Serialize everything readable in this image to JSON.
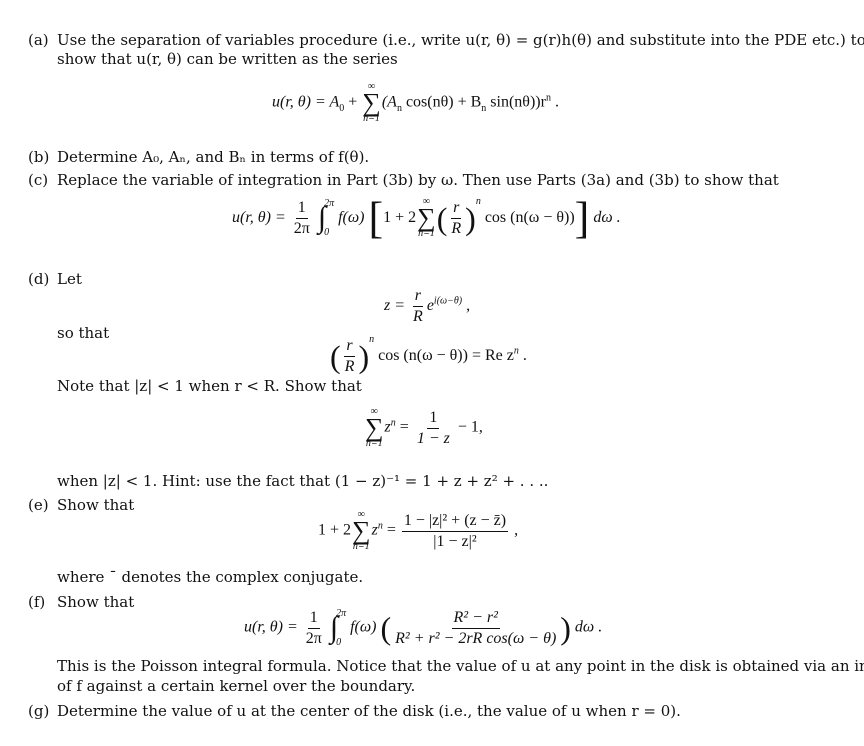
{
  "parts": {
    "a": {
      "label": "(a)",
      "line1": "Use the separation of variables procedure (i.e., write u(r, θ) = g(r)h(θ) and substitute into the PDE etc.)  to",
      "line2": "show that u(r, θ) can be written as the series",
      "equation": {
        "lhs": "u(r, θ) = A",
        "lhs_sub": "0",
        "plus": " + ",
        "sum_top": "∞",
        "sum_bottom": "n=1",
        "body": "(A",
        "body_sub": "n",
        "body2": " cos(nθ) + B",
        "body2_sub": "n",
        "body3": " sin(nθ))r",
        "body3_sup": "n",
        "end": " ."
      }
    },
    "b": {
      "label": "(b)",
      "text": "Determine A₀, Aₙ, and Bₙ in terms of f(θ)."
    },
    "c": {
      "label": "(c)",
      "text": "Replace the variable of integration in Part (3b) by ω. Then use Parts (3a) and (3b) to show that",
      "equation": {
        "lhs": "u(r, θ) =",
        "frac_num": "1",
        "frac_den": "2π",
        "int_top": "2π",
        "int_bottom": "0",
        "integrand": "f(ω)",
        "inner_start": "1 + 2",
        "sum_top": "∞",
        "sum_bottom": "n=1",
        "ratio_num": "r",
        "ratio_den": "R",
        "power": "n",
        "cos": "cos (n(ω − θ))",
        "end": "dω ."
      }
    },
    "d": {
      "label": "(d)",
      "let": "Let",
      "eq1": {
        "lhs": "z =",
        "num": "r",
        "den": "R",
        "exp_base": "e",
        "exp": "i(ω−θ)",
        "end": " ,"
      },
      "so_that": "so that",
      "eq2": {
        "num": "r",
        "den": "R",
        "power": "n",
        "rest": "cos (n(ω − θ)) = Re z",
        "rest_sup": "n",
        "end": " ."
      },
      "note": "Note that |z| < 1 when r < R. Show that",
      "eq3": {
        "sum_top": "∞",
        "sum_bottom": "n=1",
        "term": "z",
        "term_sup": "n",
        "eq": " = ",
        "num": "1",
        "den": "1 − z",
        "end": " − 1,"
      },
      "hint": "when |z| < 1. Hint: use the fact that (1 − z)⁻¹ = 1 + z + z² + . . .."
    },
    "e": {
      "label": "(e)",
      "text": "Show that",
      "equation": {
        "lhs": "1 + 2",
        "sum_top": "∞",
        "sum_bottom": "n=1",
        "term": "z",
        "term_sup": "n",
        "eq": " = ",
        "num": "1 − |z|² + (z − z̄)",
        "den": "|1 − z|²",
        "end": " ,"
      },
      "where": "where ¯ denotes the complex conjugate."
    },
    "f": {
      "label": "(f)",
      "text": "Show that",
      "equation": {
        "lhs": "u(r, θ) =",
        "frac_num": "1",
        "frac_den": "2π",
        "int_top": "2π",
        "int_bottom": "0",
        "integrand": "f(ω)",
        "num": "R² − r²",
        "den": "R² + r² − 2rR cos(ω − θ)",
        "end": "dω ."
      },
      "line1": "This is the Poisson integral formula. Notice that the value of u at any point in the disk is obtained via an integral",
      "line2": "of f against a certain kernel over the boundary."
    },
    "g": {
      "label": "(g)",
      "text": "Determine the value of u at the center of the disk (i.e., the value of u when r = 0)."
    }
  }
}
